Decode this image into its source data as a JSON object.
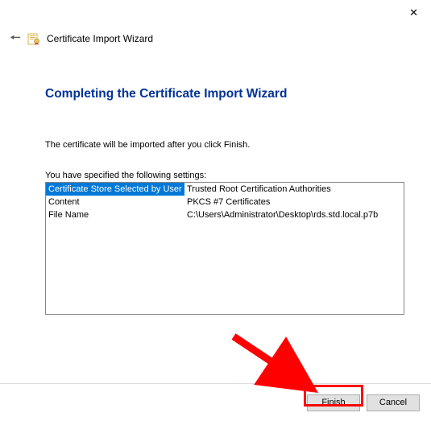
{
  "window": {
    "title": "Certificate Import Wizard"
  },
  "page": {
    "heading": "Completing the Certificate Import Wizard",
    "instruction": "The certificate will be imported after you click Finish.",
    "settings_label": "You have specified the following settings:",
    "rows": [
      {
        "label": "Certificate Store Selected by User",
        "value": "Trusted Root Certification Authorities"
      },
      {
        "label": "Content",
        "value": "PKCS #7 Certificates"
      },
      {
        "label": "File Name",
        "value": "C:\\Users\\Administrator\\Desktop\\rds.std.local.p7b"
      }
    ]
  },
  "buttons": {
    "finish": "Finish",
    "cancel": "Cancel"
  },
  "annotation": {
    "highlight_target": "finish-button",
    "arrow_color": "#ff0000"
  }
}
